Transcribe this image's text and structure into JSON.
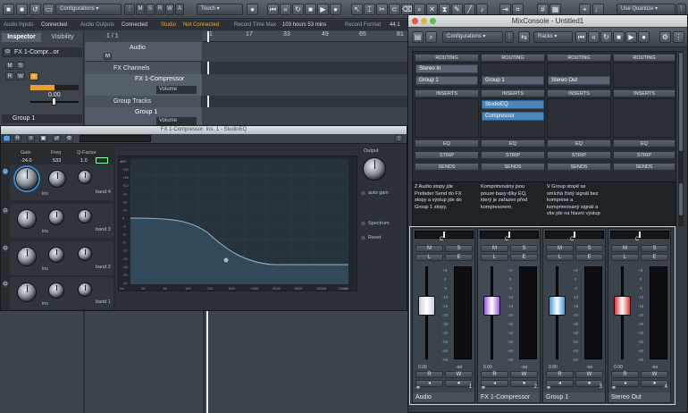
{
  "toolbar": {
    "configurations": "Configurations",
    "msrwa": [
      "M",
      "S",
      "R",
      "W",
      "A"
    ],
    "automation_mode": "Touch",
    "quantize": "Use Quantize"
  },
  "status": {
    "audio_inputs": "Audio Inputs",
    "audio_inputs_state": "Connected",
    "audio_outputs": "Audio Outputs",
    "audio_outputs_state": "Connected",
    "studio": "Studio",
    "studio_state": "Not Connected",
    "record_time_label": "Record Time Max",
    "record_time_value": "103 hours 53 mins",
    "record_format": "Record Format",
    "record_format_value": "44.1"
  },
  "inspector": {
    "tab_inspector": "Inspector",
    "tab_visibility": "Visibility",
    "track_name": "FX 1-Compr...or",
    "fader_value": "0.00",
    "output": "Group 1"
  },
  "tracklist": {
    "counter": "1 / 1",
    "audio_track": "Audio",
    "fx_folder": "FX Channels",
    "fx_track": "FX 1-Compressor",
    "volume": "Volume",
    "group_folder": "Group Tracks",
    "group_track": "Group 1",
    "group_volume": "Volume"
  },
  "ruler": [
    "1",
    "17",
    "33",
    "49",
    "65",
    "81"
  ],
  "plugin": {
    "title": "FX 1-Compressor: Ins. 1 - StudioEQ",
    "gain": "Gain",
    "freq": "Freq",
    "qfactor": "Q-Factor",
    "gain_value": "-24.0",
    "freq_value": "533",
    "q_value": "1.0",
    "band4": "band 4",
    "band3": "band 3",
    "band2": "band 2",
    "band1": "band 1",
    "inv": "inv",
    "output": "Output",
    "auto_gain": "auto gain",
    "spectrum": "Spectrum",
    "reset": "Reset",
    "db_ticks": [
      "+0",
      "+20",
      "+15",
      "+12",
      "+9",
      "+6",
      "+3",
      "0",
      "-3",
      "-6",
      "-9",
      "-12",
      "-15",
      "-18",
      "-20",
      "-24"
    ],
    "hz_ticks": [
      "20",
      "50",
      "100",
      "200",
      "500",
      "1000",
      "2000",
      "5000",
      "10000",
      "20000"
    ],
    "hz_unit": "Hz",
    "db_unit": "dB",
    "db_unit_bottom": "-oo"
  },
  "mixconsole": {
    "title": "MixConsole - Untitled1",
    "configurations": "Configurations",
    "racks": "Racks",
    "routing": "ROUTING",
    "inserts": "INSERTS",
    "eq": "EQ",
    "strip": "STRIP",
    "sends": "SENDS",
    "routing_cells": [
      "Stereo In",
      "Group 1",
      "Group 1",
      "Stereo Out"
    ],
    "insert_slots": [
      "StudioEQ",
      "Compressor"
    ],
    "notes": [
      "Z Audio stopy jde\nPrefader Send do FX\nstopy a výstup jde do\nGroup 1 stopy.",
      "Komprimovány jsou\npouze basy díky EQ,\nkterý je zařazen před\nkompresorem.",
      "V Group stopě se\nsmíchá čistý signál bez\nkomprese a\nkomprimovaný signál a\nvše jde na hlavní výstup"
    ],
    "channels": [
      {
        "name": "Audio",
        "number": "1",
        "pan": "C",
        "value": "0.00",
        "peak": "-oo",
        "color": "#c8d0d8",
        "fader": 0.72
      },
      {
        "name": "FX 1-Compressor",
        "number": "2",
        "pan": "C",
        "value": "0.00",
        "peak": "-oo",
        "color": "#9a5ad8",
        "fader": 0.72
      },
      {
        "name": "Group 1",
        "number": "3",
        "pan": "C",
        "value": "0.00",
        "peak": "-oo",
        "color": "#3a9ad8",
        "fader": 0.72
      },
      {
        "name": "Stereo Out",
        "number": "4",
        "pan": "C",
        "value": "0.00",
        "peak": "-oo",
        "color": "#d83a3a",
        "fader": 0.72
      }
    ],
    "meter_scale": [
      "+6",
      "0",
      "-5",
      "-10",
      "-15",
      "-20",
      "-30",
      "-40",
      "-50",
      "-60",
      "-80"
    ],
    "m_label": "M",
    "s_label": "S",
    "l_label": "L",
    "e_label": "E",
    "r_label": "R",
    "w_label": "W"
  }
}
